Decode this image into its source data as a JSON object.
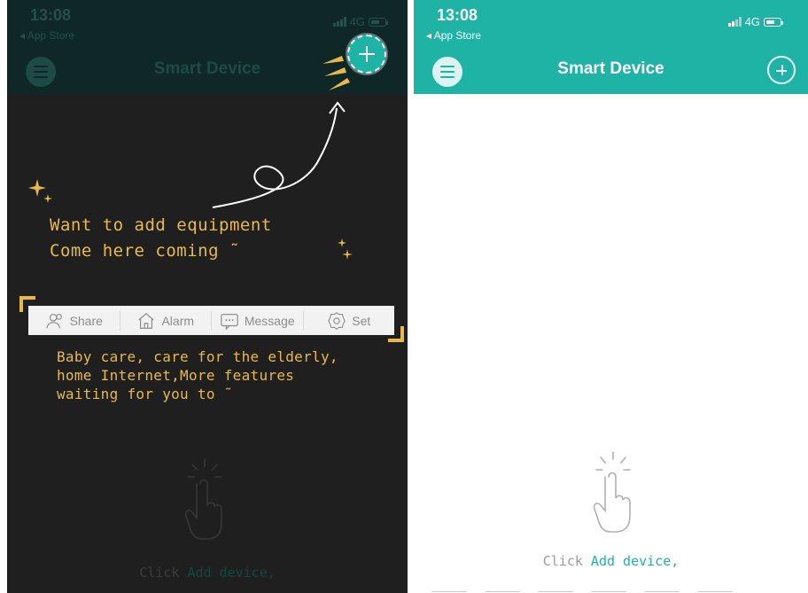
{
  "status": {
    "time": "13:08",
    "back_label": "App Store",
    "network": "4G"
  },
  "header": {
    "title": "Smart Device",
    "menu_icon": "list-menu-icon",
    "add_icon": "plus-icon"
  },
  "guide": {
    "tip_add_line1": "Want to add equipment",
    "tip_add_line2": "Come here coming ˜",
    "tip_features_line1": "Baby care, care for the elderly,",
    "tip_features_line2": "home Internet,More features",
    "tip_features_line3": "waiting for you to ˜"
  },
  "toolbar": {
    "items": [
      {
        "label": "Share",
        "icon": "share-users-icon"
      },
      {
        "label": "Alarm",
        "icon": "home-alarm-icon"
      },
      {
        "label": "Message",
        "icon": "message-bubble-icon"
      },
      {
        "label": "Set",
        "icon": "settings-gear-icon"
      }
    ]
  },
  "empty_state": {
    "hint_prefix": "Click ",
    "hint_action": "Add device,",
    "icon": "tap-hand-icon"
  },
  "colors": {
    "accent": "#1fb3a5",
    "guide_text": "#e8b94a",
    "overlay": "#1f1f1f"
  }
}
